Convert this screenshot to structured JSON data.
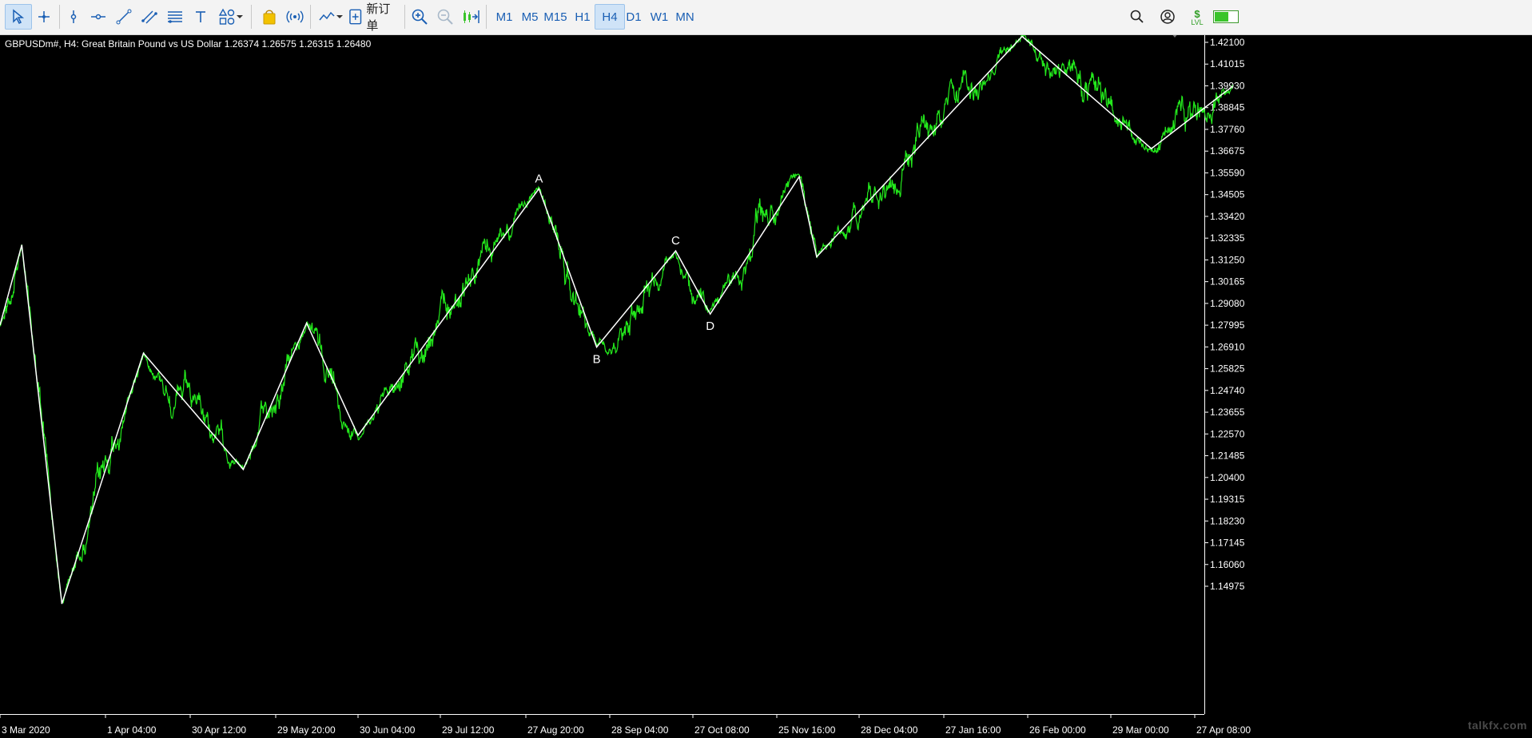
{
  "toolbar": {
    "new_order_label": "新订单",
    "timeframes": [
      "M1",
      "M5",
      "M15",
      "H1",
      "H4",
      "D1",
      "W1",
      "MN"
    ],
    "active_timeframe": "H4",
    "lvl_label": "LVL",
    "signal_level": 0.6
  },
  "chart_header": {
    "text": "GBPUSDm#, H4:  Great Britain Pound vs US Dollar  1.26374 1.26575 1.26315 1.26480"
  },
  "watermark": "talkfx.com",
  "colors": {
    "background": "#000000",
    "price_line": "#23e81c",
    "zigzag": "#ffffff",
    "axis_text": "#ffffff",
    "toolbar_accent": "#1a5fb4"
  },
  "chart_data": {
    "type": "line",
    "symbol": "GBPUSDm#",
    "timeframe": "H4",
    "ylim": [
      1.14,
      1.426
    ],
    "y_ticks": [
      "1.42100",
      "1.41015",
      "1.39930",
      "1.38845",
      "1.37760",
      "1.36675",
      "1.35590",
      "1.34505",
      "1.33420",
      "1.32335",
      "1.31250",
      "1.30165",
      "1.29080",
      "1.27995",
      "1.26910",
      "1.25825",
      "1.24740",
      "1.23655",
      "1.22570",
      "1.21485",
      "1.20400",
      "1.19315",
      "1.18230",
      "1.17145",
      "1.16060",
      "1.14975"
    ],
    "x_ticks": [
      "3 Mar 2020",
      "1 Apr 04:00",
      "30 Apr 12:00",
      "29 May 20:00",
      "30 Jun 04:00",
      "29 Jul 12:00",
      "27 Aug 20:00",
      "28 Sep 04:00",
      "27 Oct 08:00",
      "25 Nov 16:00",
      "28 Dec 04:00",
      "27 Jan 16:00",
      "26 Feb 00:00",
      "29 Mar 00:00",
      "27 Apr 08:00"
    ],
    "grid": false,
    "zigzag": [
      {
        "date": "2020-03-03",
        "price": 1.28
      },
      {
        "date": "2020-03-09",
        "price": 1.32
      },
      {
        "date": "2020-03-20",
        "price": 1.141
      },
      {
        "date": "2020-04-14",
        "price": 1.266
      },
      {
        "date": "2020-05-18",
        "price": 1.208
      },
      {
        "date": "2020-06-10",
        "price": 1.281
      },
      {
        "date": "2020-06-30",
        "price": 1.225
      },
      {
        "date": "2020-09-01",
        "price": 1.348,
        "label": "A"
      },
      {
        "date": "2020-09-23",
        "price": 1.269,
        "label": "B"
      },
      {
        "date": "2020-10-21",
        "price": 1.317,
        "label": "C"
      },
      {
        "date": "2020-11-02",
        "price": 1.2855,
        "label": "D"
      },
      {
        "date": "2020-12-04",
        "price": 1.354
      },
      {
        "date": "2020-12-11",
        "price": 1.314
      },
      {
        "date": "2021-02-24",
        "price": 1.424
      },
      {
        "date": "2021-04-12",
        "price": 1.368
      },
      {
        "date": "2021-05-10",
        "price": 1.399
      }
    ]
  }
}
